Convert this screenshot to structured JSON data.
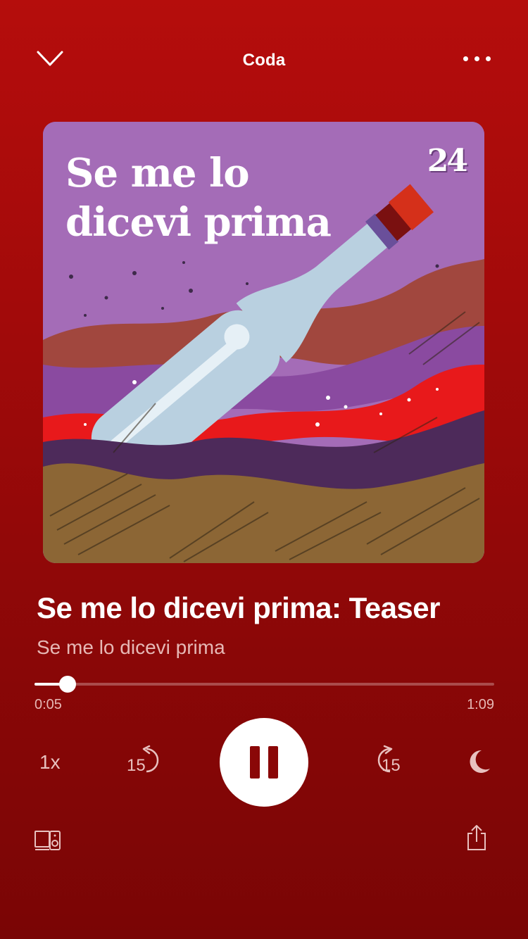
{
  "header": {
    "title": "Coda"
  },
  "icons": {
    "collapse": "chevron-down-icon",
    "more": "more-options-icon",
    "skip_back": "skip-back-15-icon",
    "skip_forward": "skip-forward-15-icon",
    "pause": "pause-icon",
    "sleep_timer": "moon-icon",
    "devices": "connect-device-icon",
    "share": "share-icon"
  },
  "cover": {
    "title_line1": "Se me lo",
    "title_line2": "dicevi prima",
    "badge": "24"
  },
  "episode": {
    "title": "Se me lo dicevi prima: Teaser",
    "show": "Se me lo dicevi prima"
  },
  "playback": {
    "elapsed": "0:05",
    "duration": "1:09",
    "progress_fraction": 0.0725,
    "speed": "1x",
    "skip_back_seconds": "15",
    "skip_forward_seconds": "15"
  },
  "colors": {
    "background": "#a10a0a",
    "cover_purple": "#a46cb7",
    "accent_text": "#e6b8b5"
  }
}
